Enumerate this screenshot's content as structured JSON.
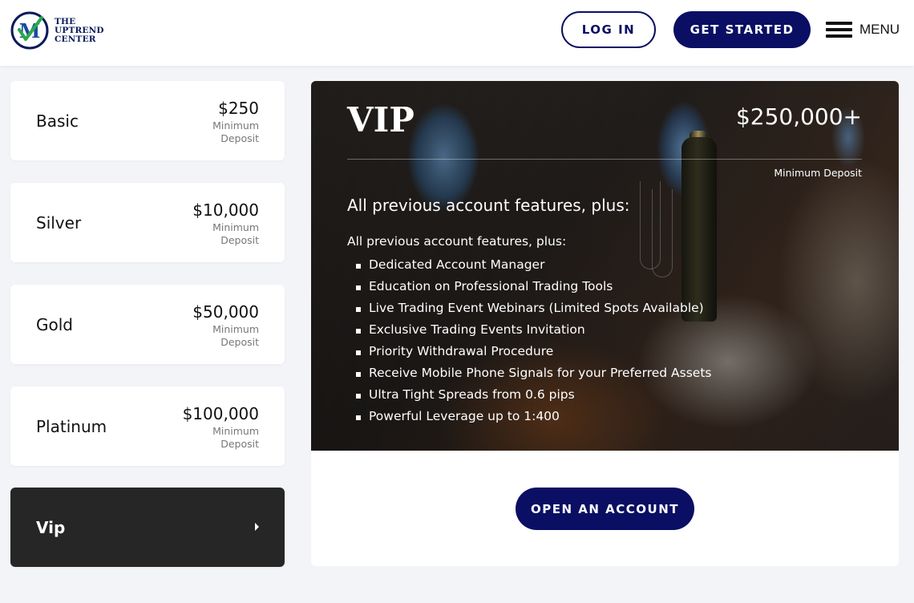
{
  "header": {
    "logo_text_line1": "THE",
    "logo_text_line2": "UPTREND",
    "logo_text_line3": "CENTER",
    "login_label": "LOG IN",
    "get_started_label": "GET STARTED",
    "menu_label": "MENU",
    "icons": [
      "logo-icon",
      "hamburger-menu-icon"
    ]
  },
  "plans": [
    {
      "name": "Basic",
      "price": "$250",
      "min_line1": "Minimum",
      "min_line2": "Deposit"
    },
    {
      "name": "Silver",
      "price": "$10,000",
      "min_line1": "Minimum",
      "min_line2": "Deposit"
    },
    {
      "name": "Gold",
      "price": "$50,000",
      "min_line1": "Minimum",
      "min_line2": "Deposit"
    },
    {
      "name": "Platinum",
      "price": "$100,000",
      "min_line1": "Minimum",
      "min_line2": "Deposit"
    },
    {
      "name": "Vip",
      "active": true,
      "arrow_icon": "caret-right-icon"
    }
  ],
  "vip": {
    "title": "VIP",
    "price": "$250,000+",
    "min_label": "Minimum Deposit",
    "subtitle": "All previous account features, plus:",
    "intro": "All previous account features, plus:",
    "features": [
      "Dedicated Account Manager",
      "Education on Professional Trading Tools",
      "Live Trading Event Webinars (Limited Spots Available)",
      "Exclusive Trading Events Invitation",
      "Priority Withdrawal Procedure",
      "Receive Mobile Phone Signals for your Preferred Assets",
      "Ultra Tight Spreads from 0.6 pips",
      "Powerful Leverage up to 1:400"
    ],
    "cta_label": "OPEN AN ACCOUNT"
  },
  "colors": {
    "brand_navy": "#0a0f63",
    "active_plan_bg": "#262626",
    "page_bg": "#f3f4f8"
  }
}
